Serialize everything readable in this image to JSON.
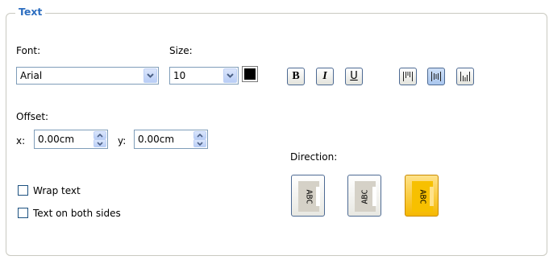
{
  "group": {
    "title": "Text"
  },
  "font": {
    "label": "Font:",
    "value": "Arial"
  },
  "size": {
    "label": "Size:",
    "value": "10"
  },
  "text_color": "#000000",
  "format_buttons": {
    "bold": "B",
    "italic": "I",
    "underline": "U"
  },
  "offset": {
    "label": "Offset:",
    "x_label": "x:",
    "x_value": "0.00cm",
    "y_label": "y:",
    "y_value": "0.00cm"
  },
  "options": {
    "wrap_text": {
      "label": "Wrap text",
      "checked": false
    },
    "both_sides": {
      "label": "Text on both sides",
      "checked": false
    }
  },
  "direction": {
    "label": "Direction:",
    "buttons": [
      {
        "text": "ABC",
        "selected": false
      },
      {
        "text": "ABC",
        "selected": false
      },
      {
        "text": "ABC",
        "selected": true
      }
    ]
  },
  "colors": {
    "accent": "#2d6ec0",
    "selected": "#f5b800",
    "border": "#4d6a93"
  }
}
